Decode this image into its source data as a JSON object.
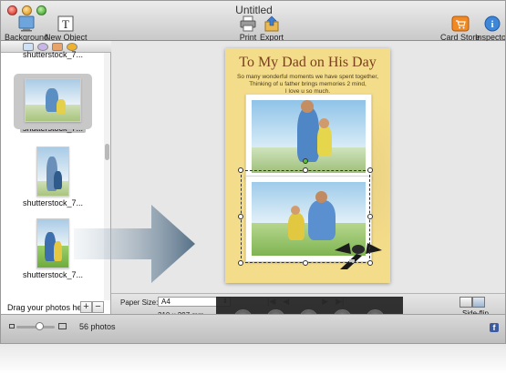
{
  "window": {
    "title": "Untitled"
  },
  "toolbar": {
    "background": "Background",
    "new_object": "New Object",
    "print": "Print",
    "export": "Export",
    "card_store": "Card Store",
    "inspector": "Inspector"
  },
  "sidebar": {
    "tabs": [
      "photos-tab-icon",
      "shapes-tab-icon",
      "backgrounds-tab-icon",
      "effects-tab-icon"
    ],
    "items": [
      {
        "caption": "shutterstock_7...",
        "selected": false
      },
      {
        "caption": "shutterstock_7...",
        "selected": true
      },
      {
        "caption": "shutterstock_7...",
        "selected": false
      },
      {
        "caption": "shutterstock_7...",
        "selected": false
      }
    ],
    "drag_hint": "Drag your photos here",
    "add": "+",
    "remove": "−"
  },
  "card": {
    "title": "To My Dad on His Day",
    "subtitle": "So many wonderful moments we have spent together,\nThinking of u father brings memories 2 mind,\nI love u so much.",
    "colors": {
      "background": "#f4dd8a",
      "title": "#7a3f1d"
    }
  },
  "bottom": {
    "paper_size_label": "Paper Size:",
    "paper_size_value": "A4",
    "paper_dimensions": "210 x 297 mm",
    "side_flip": "Side-flip"
  },
  "overlay": {
    "buttons": [
      "rotate-left-icon",
      "rotate-right-icon",
      "crop-icon",
      "bring-forward-icon",
      "send-backward-icon"
    ]
  },
  "status": {
    "photo_count": "56 photos",
    "zoom_fraction": 0.6
  }
}
